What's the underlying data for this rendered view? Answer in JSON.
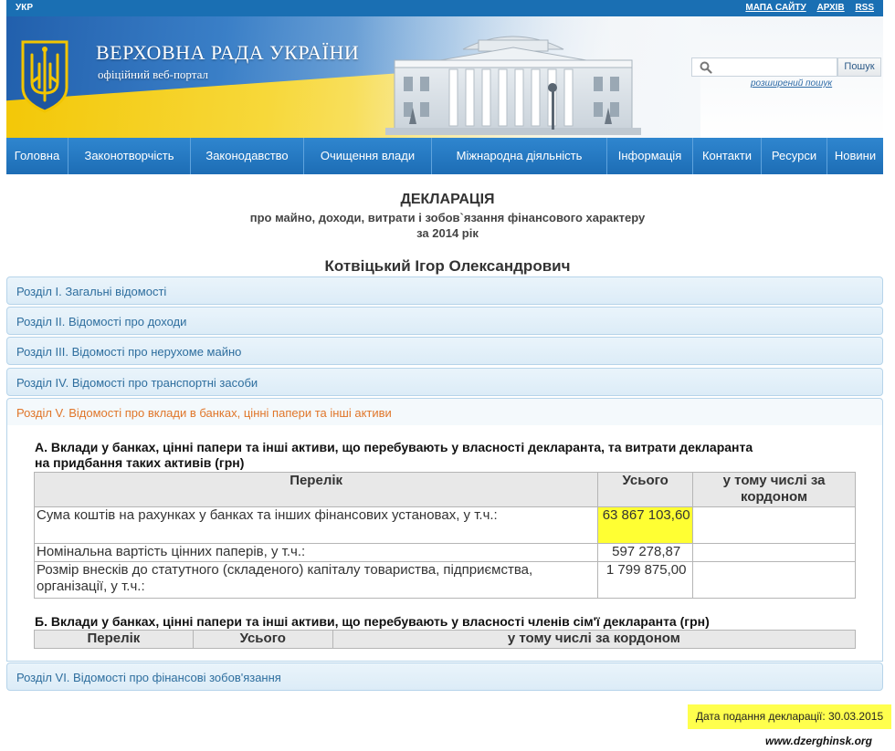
{
  "topbar": {
    "lang": "УКР",
    "links": [
      "МАПА САЙТУ",
      "АРХІВ",
      "RSS"
    ]
  },
  "header": {
    "title": "ВЕРХОВНА РАДА УКРАЇНИ",
    "subtitle": "офіційний веб-портал",
    "search_placeholder": "",
    "search_button": "Пошук",
    "advanced_search": "розширений пошук"
  },
  "nav": [
    "Головна",
    "Законотворчість",
    "Законодавство",
    "Очищення влади",
    "Міжнародна діяльність",
    "Інформація",
    "Контакти",
    "Ресурси",
    "Новини"
  ],
  "declaration": {
    "title": "ДЕКЛАРАЦІЯ",
    "line2": "про майно, доходи, витрати і зобов`язання фінансового характеру",
    "line3": "за 2014 рік",
    "person": "Котвіцький Ігор Олександрович"
  },
  "sections": [
    "Розділ I. Загальні відомості",
    "Розділ II. Відомості про доходи",
    "Розділ III. Відомості про нерухоме майно",
    "Розділ IV. Відомості про транспортні засоби",
    "Розділ V. Відомості про вклади в банках, цінні папери та інші активи",
    "Розділ VI. Відомості про фінансові зобов'язання"
  ],
  "section5": {
    "a_title_1": "А. Вклади у банках, цінні папери та інші активи, що перебувають у власності декларанта, та витрати декларанта",
    "a_title_2": "на придбання таких активів (грн)",
    "a_headers": [
      "Перелік",
      "Усього",
      "у тому числі за кордоном"
    ],
    "a_rows": [
      {
        "label": "Сума коштів на рахунках у банках та інших фінансових установах, у т.ч.:",
        "total": "63 867 103,60",
        "abroad": ""
      },
      {
        "label": "Номінальна вартість цінних паперів, у т.ч.:",
        "total": "597 278,87",
        "abroad": ""
      },
      {
        "label": "Розмір внесків до статутного (складеного) капіталу товариства, підприємства, організації, у т.ч.:",
        "total": "1 799 875,00",
        "abroad": ""
      }
    ],
    "b_title": "Б. Вклади у банках, цінні папери та інші активи, що перебувають у власності членів сім'ї декларанта (грн)",
    "b_headers": [
      "Перелік",
      "Усього",
      "у тому числі за кордоном"
    ]
  },
  "submission_date": "Дата подання декларації: 30.03.2015",
  "watermark": "www.dzerghinsk.org",
  "colors": {
    "nav_blue": "#1d6db5",
    "section_link": "#2e6e9e",
    "active_section": "#e0762a",
    "highlight": "#ffff33"
  }
}
